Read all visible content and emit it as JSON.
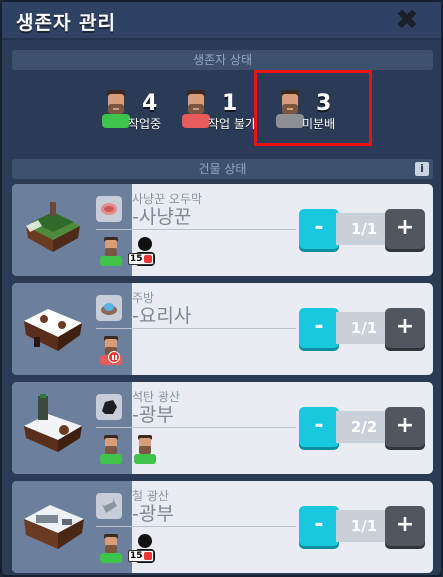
{
  "window": {
    "title": "생존자 관리",
    "close": "✖"
  },
  "status_section": {
    "title": "생존자 상태"
  },
  "workers": [
    {
      "count": "4",
      "label": "작업중",
      "color": "#3ec44a"
    },
    {
      "count": "1",
      "label": "작업 불가",
      "color": "#e75b5b"
    },
    {
      "count": "3",
      "label": "미분배",
      "color": "#8c8f94"
    }
  ],
  "buildings_section": {
    "title": "건물 상태",
    "info": "i"
  },
  "buildings": [
    {
      "name": "사냥꾼 오두막",
      "role": "-사냥꾼",
      "resource_icon": "meat-icon",
      "assigned": "1/1",
      "minus": "-",
      "plus": "+"
    },
    {
      "name": "주방",
      "role": "-요리사",
      "resource_icon": "food-icon",
      "assigned": "1/1",
      "minus": "-",
      "plus": "+"
    },
    {
      "name": "석탄 광산",
      "role": "-광부",
      "resource_icon": "coal-icon",
      "assigned": "2/2",
      "minus": "-",
      "plus": "+"
    },
    {
      "name": "철 광산",
      "role": "-광부",
      "resource_icon": "iron-icon",
      "assigned": "1/1",
      "minus": "-",
      "plus": "+"
    }
  ],
  "locked_level": "15"
}
